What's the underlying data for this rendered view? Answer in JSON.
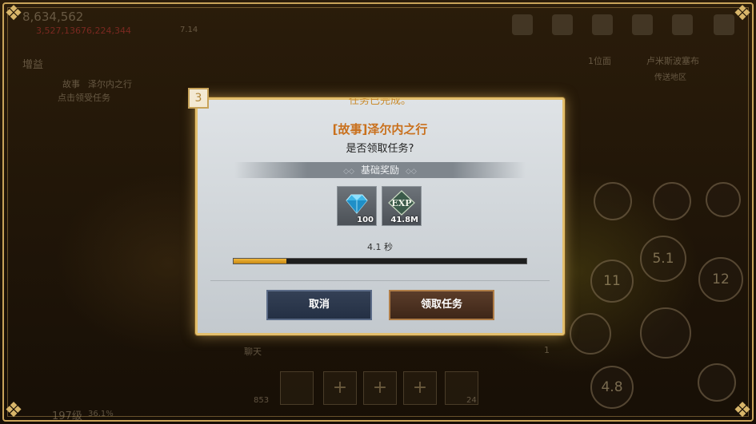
{
  "hud": {
    "power": "8,634,562",
    "currency": "3,527,13676,224,344",
    "buff_label": "增益",
    "small_value": "7.14",
    "quest_tag": "故事",
    "quest_name": "泽尔内之行",
    "quest_hint": "点击领受任务",
    "location_select": "1位面",
    "location_name": "卢米斯波塞布",
    "location_sub": "传送地区",
    "chat_label": "聊天",
    "level": "197级",
    "level_sub": "36.1%",
    "skill_counts": [
      "5.1",
      "11",
      "12",
      "4.8"
    ],
    "slot_counts": [
      "853",
      "24",
      "1"
    ],
    "page_num": "1"
  },
  "dialog": {
    "step": "3",
    "top_text": "任务已完成。",
    "quest_title": "[故事]泽尔内之行",
    "question": "是否领取任务?",
    "reward_section": "基础奖励",
    "rewards": [
      {
        "icon": "diamond-icon",
        "qty": "100"
      },
      {
        "icon": "exp-icon",
        "label": "EXP",
        "qty": "41.8M"
      }
    ],
    "timer": "4.1 秒",
    "progress": 0.18,
    "cancel_label": "取消",
    "accept_label": "领取任务"
  },
  "colors": {
    "frame_gold": "#c9a45a",
    "title_orange": "#c9701c",
    "progress_fill": "#e0a22a",
    "cancel_bg": "#2c384c",
    "accept_bg": "#4a3020"
  }
}
